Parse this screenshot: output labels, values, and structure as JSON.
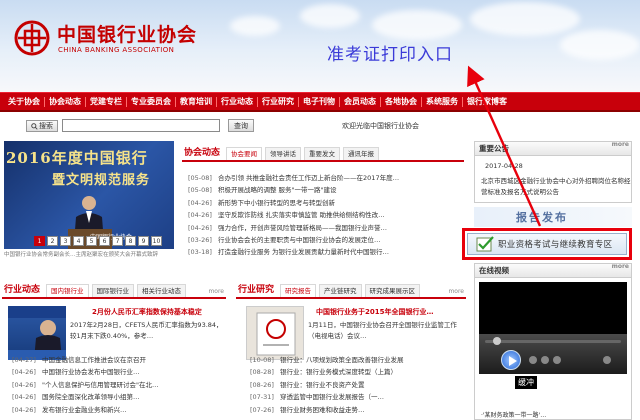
{
  "header": {
    "logo_cn": "中国银行业协会",
    "logo_en": "CHINA BANKING ASSOCIATION",
    "overlay_text": "准考证打印入口"
  },
  "nav": [
    "关于协会",
    "协会动态",
    "党建专栏",
    "专业委员会",
    "教育培训",
    "行业动态",
    "行业研究",
    "电子刊物",
    "会员动态",
    "各地协会",
    "系统服务",
    "银行家博客"
  ],
  "search": {
    "button_label": "搜索",
    "input_value": "",
    "query_label": "查询",
    "welcome": "欢迎光临中国银行业协会"
  },
  "slideshow": {
    "title_line1": "2016年度中国银行",
    "title_line2": "暨文明规范服务",
    "caption": "中国银行业协会",
    "numbers": [
      "1",
      "2",
      "3",
      "4",
      "5",
      "6",
      "7",
      "8",
      "9",
      "10"
    ],
    "active": "1",
    "desc": "中国银行业协会常务副会长…主席赵聚宏在颁奖大会开幕式致辞"
  },
  "association_news": {
    "title": "协会动态",
    "tabs": [
      "协会要闻",
      "领导讲话",
      "重要发文",
      "通讯年报"
    ],
    "active_tab": "协会要闻",
    "items": [
      {
        "date": "[05-08]",
        "text": "合办引领 共推金融社会责任工作迈上新台阶——在2017年度…"
      },
      {
        "date": "[05-08]",
        "text": "积极开展战略的调整 服务\"一带一路\"建设"
      },
      {
        "date": "[04-26]",
        "text": "新形势下中小银行转型的思考与转型创新"
      },
      {
        "date": "[04-26]",
        "text": "坚守反欺诈防线 扎实落实审慎监管 助推供给侧结构性改…"
      },
      {
        "date": "[04-26]",
        "text": "强力合作，开创声誉风险管理新格局——我国银行业声誉…"
      },
      {
        "date": "[03-26]",
        "text": "行业协会会长的主要职责与中国银行业协会的发展定位…"
      },
      {
        "date": "[03-18]",
        "text": "打造金融行业服务 为银行业发展贡献力量新时代中国银行…"
      }
    ]
  },
  "sidebar": {
    "title": "重要公告",
    "more": "more",
    "date": "2017-04-28",
    "notice": "北京市西城区金融行业协会中心对外招聘岗位名称经营标准及报名方式说明公告"
  },
  "report_banner": "报告发布",
  "exam_banner": "职业资格考试与继续教育专区",
  "video": {
    "title": "在线视频",
    "more": "more",
    "buffer": "缓冲",
    "news": "·'某财务政策一带一路'…"
  },
  "industry_news": {
    "title": "行业动态",
    "tabs": [
      "国内银行业",
      "国际银行业",
      "相关行业动态"
    ],
    "more": "more",
    "headline": "2月份人民币汇率指数保持基本稳定",
    "summary": "2017年2月28日，CFETS人民币汇率指数为93.84，较1月末下跌0.40%，参考…",
    "items": [
      {
        "date": "[04-27]",
        "text": "中国金融信息工作推进会议在京召开"
      },
      {
        "date": "[04-26]",
        "text": "中国银行业协会发布中国银行业…"
      },
      {
        "date": "[04-26]",
        "text": "\"个人信息保护与信用管理研讨会\"在北…"
      },
      {
        "date": "[04-26]",
        "text": "国务院全面深化改革领导小组第…"
      },
      {
        "date": "[04-26]",
        "text": "发布银行业金融业务和新兴…"
      }
    ]
  },
  "research": {
    "title": "行业研究",
    "tabs": [
      "研究报告",
      "产业链研究",
      "研究成果展示区"
    ],
    "more": "more",
    "headline": "中国银行业务于2015年全国银行业…",
    "summary": "1月11日，中国银行业协会召开全国银行业监管工作（电视电话）会议…",
    "items": [
      {
        "date": "[10-08]",
        "text": "银行业：八项规划政策全面改善银行业发展"
      },
      {
        "date": "[08-28]",
        "text": "银行业：银行业务模式深度转型（上篇）"
      },
      {
        "date": "[08-26]",
        "text": "银行业：银行业不良资产处置"
      },
      {
        "date": "[07-31]",
        "text": "穿透监管中国银行业发展报告（一…"
      },
      {
        "date": "[07-26]",
        "text": "银行业财务困难和收益走势…"
      }
    ]
  }
}
